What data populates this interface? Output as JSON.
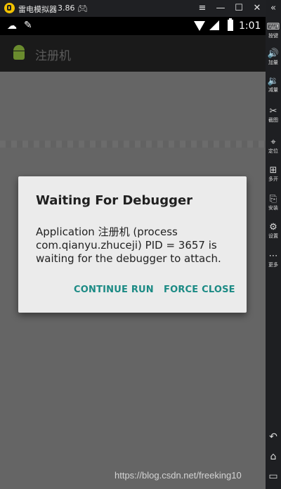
{
  "emulator": {
    "title": "雷电模拟器",
    "version": "3.86",
    "window_buttons": {
      "menu": "≡",
      "minimize": "—",
      "maximize": "☐",
      "close": "✕"
    }
  },
  "sidebar": {
    "items": [
      {
        "icon": "keyboard-icon",
        "glyph": "⌨",
        "label": "按键"
      },
      {
        "icon": "volume-up-icon",
        "glyph": "🔊",
        "label": "加量"
      },
      {
        "icon": "volume-down-icon",
        "glyph": "🔉",
        "label": "减量"
      },
      {
        "icon": "scissors-icon",
        "glyph": "✂",
        "label": "截图"
      },
      {
        "icon": "location-icon",
        "glyph": "⌖",
        "label": "定位"
      },
      {
        "icon": "multi-open-icon",
        "glyph": "⊞",
        "label": "多开"
      },
      {
        "icon": "apk-install-icon",
        "glyph": "⎘",
        "label": "安装"
      },
      {
        "icon": "settings-icon",
        "glyph": "⚙",
        "label": "设置"
      },
      {
        "icon": "more-icon",
        "glyph": "⋯",
        "label": "更多"
      }
    ],
    "nav": {
      "back": "↶",
      "home": "⌂",
      "recents": "▭"
    }
  },
  "statusbar": {
    "time": "1:01"
  },
  "appbar": {
    "title": "注册机"
  },
  "dialog": {
    "title": "Waiting For Debugger",
    "message": "Application 注册机 (process com.qianyu.zhuceji) PID = 3657 is waiting for the debugger to attach.",
    "continue_label": "CONTINUE RUN",
    "force_close_label": "FORCE CLOSE"
  },
  "watermark": "https://blog.csdn.net/freeking10",
  "colors": {
    "accent": "#1b8a84",
    "dialog_bg": "#ebebeb",
    "scrim": "#656565"
  }
}
